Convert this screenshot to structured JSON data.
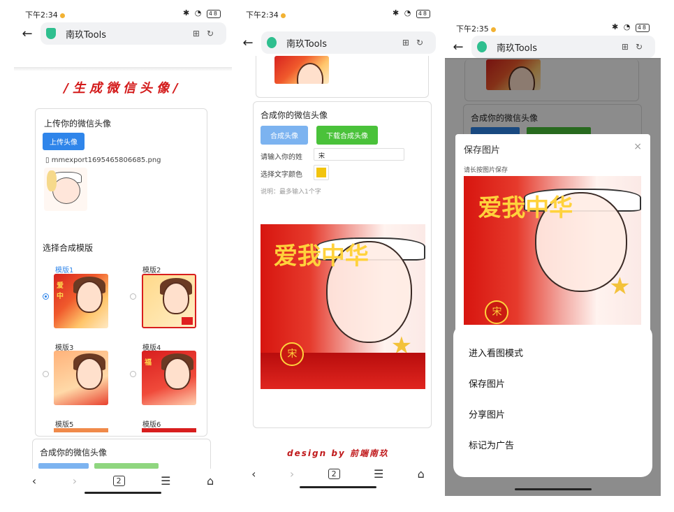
{
  "status_left": {
    "p1": "下午2:34",
    "p2": "下午2:34",
    "p3": "下午2:35"
  },
  "status_right": {
    "battery": "48"
  },
  "url": {
    "title": "南玖Tools"
  },
  "screen1": {
    "banner": "/生成微信头像/",
    "upload_card": {
      "title": "上传你的微信头像",
      "button": "上传头像",
      "filename": "mmexport1695465806685.png"
    },
    "template_card": {
      "title": "选择合成模版",
      "templates": [
        "模版1",
        "模版2",
        "模版3",
        "模版4",
        "模版5",
        "模版6"
      ],
      "selected": "模版1"
    },
    "compose_title": "合成你的微信头像"
  },
  "screen2": {
    "compose_title": "合成你的微信头像",
    "btn_compose": "合成头像",
    "btn_download": "下载合成头像",
    "surname_label": "请输入你的姓",
    "surname_value": "宋",
    "color_label": "选择文字颜色",
    "color_value": "#f2c40e",
    "note": "说明：最多输入1个字",
    "image_text": "爱我中华",
    "seal_text": "宋",
    "footer": "design by 前端南玖"
  },
  "screen3": {
    "compose_title": "合成你的微信头像",
    "modal_title": "保存图片",
    "modal_hint": "请长按图片保存",
    "close": "×",
    "sheet_items": [
      "进入看图模式",
      "保存图片",
      "分享图片",
      "标记为广告"
    ]
  },
  "nav": {
    "back": "‹",
    "forward": "›",
    "tabs_count": "2",
    "menu": "☰",
    "home": "⌂"
  }
}
